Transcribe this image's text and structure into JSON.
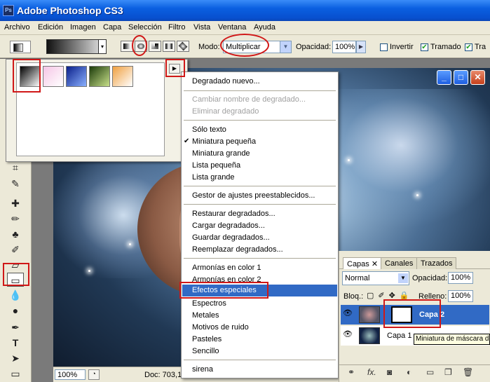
{
  "app": {
    "title": "Adobe Photoshop CS3"
  },
  "menu": [
    "Archivo",
    "Edición",
    "Imagen",
    "Capa",
    "Selección",
    "Filtro",
    "Vista",
    "Ventana",
    "Ayuda"
  ],
  "options": {
    "mode_label": "Modo:",
    "mode_value": "Multiplicar",
    "opacity_label": "Opacidad:",
    "opacity_value": "100%",
    "invert_label": "Invertir",
    "dither_label": "Tramado",
    "transparency_label": "Tra",
    "invert_checked": false,
    "dither_checked": true,
    "transparency_checked": true
  },
  "presets": {
    "swatches": [
      {
        "name": "black-white",
        "gradient": "linear-gradient(135deg,#000,#fff)"
      },
      {
        "name": "pink-checker",
        "gradient": "linear-gradient(135deg,#f5c6e6,#fff)"
      },
      {
        "name": "blue",
        "gradient": "linear-gradient(135deg,#0a1f8a,#8ab0ff)"
      },
      {
        "name": "green",
        "gradient": "linear-gradient(135deg,#1b3a0a,#c8e08a)"
      },
      {
        "name": "orange-checker",
        "gradient": "linear-gradient(135deg,#f0a040,#fff)"
      }
    ]
  },
  "dropdown": {
    "new_gradient": "Degradado nuevo...",
    "rename": "Cambiar nombre de degradado...",
    "delete": "Eliminar degradado",
    "text_only": "Sólo texto",
    "small_thumb": "Miniatura pequeña",
    "large_thumb": "Miniatura grande",
    "small_list": "Lista pequeña",
    "large_list": "Lista grande",
    "preset_manager": "Gestor de ajustes preestablecidos...",
    "reset": "Restaurar degradados...",
    "load": "Cargar degradados...",
    "save": "Guardar degradados...",
    "replace": "Reemplazar degradados...",
    "harmonies1": "Armonías en color 1",
    "harmonies2": "Armonías en color 2",
    "special_effects": "Efectos especiales",
    "spectrums": "Espectros",
    "metals": "Metales",
    "noise": "Motivos de ruido",
    "pastels": "Pasteles",
    "simple": "Sencillo",
    "sirena": "sirena"
  },
  "document": {
    "zoom": "100%",
    "doc_info": "Doc: 703,1"
  },
  "layers": {
    "tabs": [
      "Capas",
      "Canales",
      "Trazados"
    ],
    "blend_mode": "Normal",
    "opacity_label": "Opacidad:",
    "opacity_value": "100%",
    "lock_label": "Bloq.:",
    "fill_label": "Relleno:",
    "fill_value": "100%",
    "layer2": "Capa 2",
    "layer1": "Capa 1",
    "tooltip": "Miniatura de máscara de capa"
  },
  "colors": {
    "highlight": "#316ac5",
    "annotation": "#d01818",
    "xp_blue": "#0a5fe0"
  }
}
